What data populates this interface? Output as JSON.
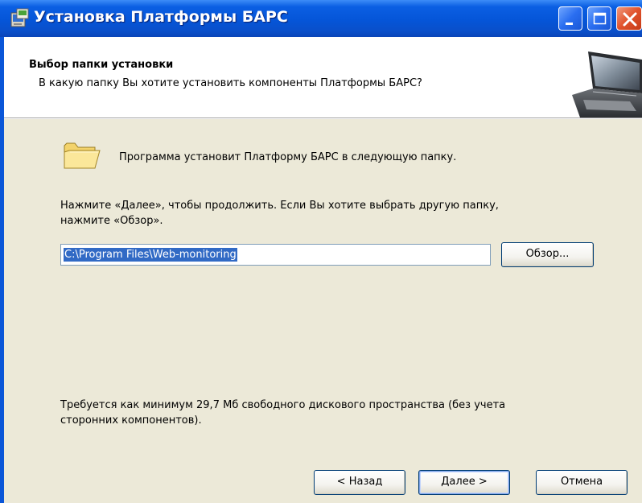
{
  "window": {
    "title": "Установка Платформы БАРС",
    "controls": {
      "minimize": "minimize-icon",
      "maximize": "maximize-icon",
      "close": "close-icon"
    }
  },
  "header": {
    "title": "Выбор папки установки",
    "subtitle": "В какую папку Вы хотите установить компоненты Платформы БАРС?",
    "image": "laptop-icon"
  },
  "body": {
    "folder_message": "Программа установит Платформу БАРС в следующую папку.",
    "instruction_line1": "Нажмите «Далее», чтобы продолжить. Если Вы хотите выбрать другую папку,",
    "instruction_line2": "нажмите «Обзор».",
    "path_value": "C:\\Program Files\\Web-monitoring",
    "browse_label": "Обзор...",
    "requirement_line1": "Требуется как минимум 29,7 Мб свободного дискового пространства (без учета",
    "requirement_line2": "сторонних компонентов)."
  },
  "footer": {
    "back_label": "< Назад",
    "next_label": "Далее >",
    "cancel_label": "Отмена"
  },
  "colors": {
    "titlebar": "#0555d8",
    "dialog_background": "#ece9d8",
    "selection": "#316ac5"
  }
}
